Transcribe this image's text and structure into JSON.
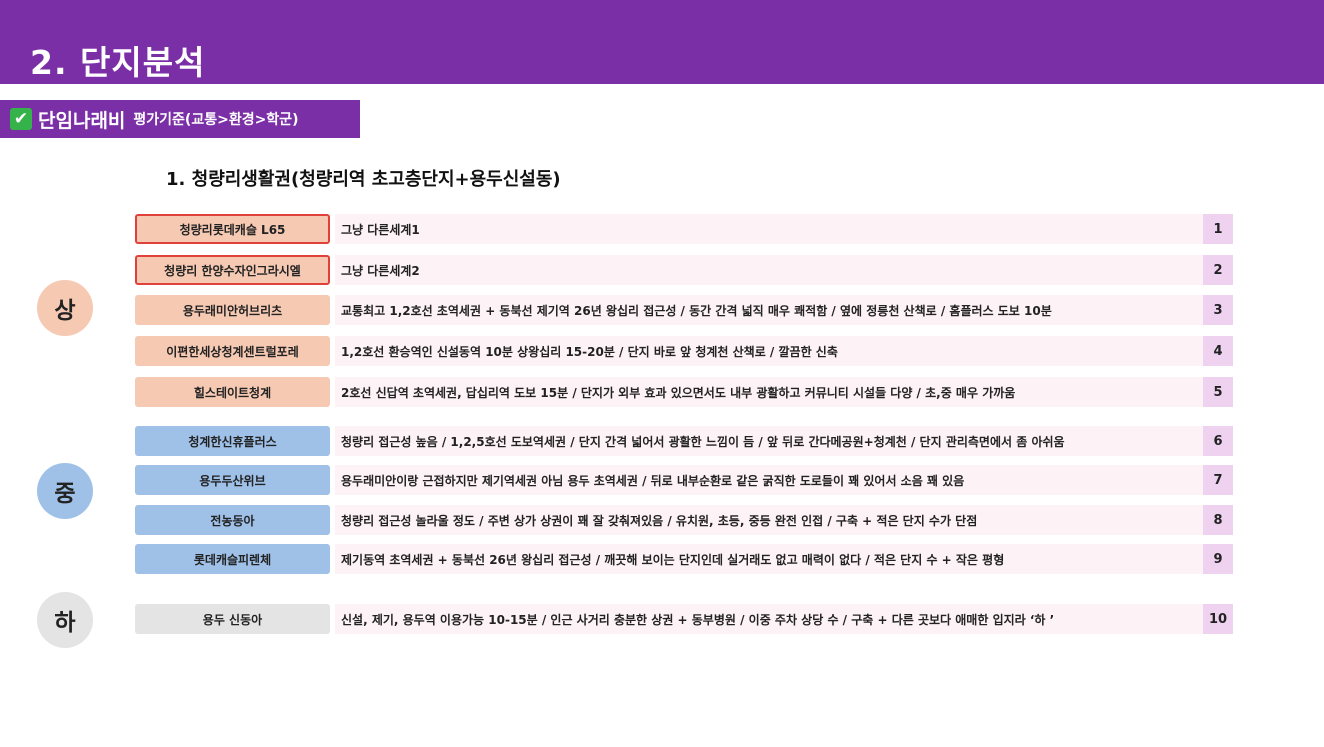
{
  "header": {
    "title": "2. 단지분석"
  },
  "badge": {
    "check": "✔",
    "title": "단임나래비",
    "criteria": "평가기준(교통>환경>학군)"
  },
  "section": {
    "title": "1. 청량리생활권(청량리역 초고층단지+용두신설동)"
  },
  "tiers": [
    {
      "label": "상",
      "color": "#f6c9b3"
    },
    {
      "label": "중",
      "color": "#9fc1e8"
    },
    {
      "label": "하",
      "color": "#e4e4e4"
    }
  ],
  "rows": [
    {
      "label": "청량리롯데캐슬 L65",
      "desc": "그냥 다른세계1",
      "num": "1",
      "color": "#f6c9b3",
      "outlined": true
    },
    {
      "label": "청량리 한양수자인그라시엘",
      "desc": "그냥 다른세계2",
      "num": "2",
      "color": "#f6c9b3",
      "outlined": true
    },
    {
      "label": "용두래미안허브리츠",
      "desc": "교통최고 1,2호선 초역세권 + 동북선 제기역 26년 왕십리 접근성 / 동간 간격 넓직 매우 쾌적함 / 옆에 정릉천 산책로 / 홈플러스 도보 10분",
      "num": "3",
      "color": "#f6c9b3",
      "outlined": false
    },
    {
      "label": "이편한세상청계센트럴포레",
      "desc": "1,2호선 환승역인 신설동역 10분 상왕십리 15-20분 / 단지 바로 앞 청계천 산책로 / 깔끔한 신축",
      "num": "4",
      "color": "#f6c9b3",
      "outlined": false
    },
    {
      "label": "힐스테이트청계",
      "desc": "2호선 신답역 초역세권, 답십리역 도보 15분 / 단지가 외부 효과 있으면서도 내부 광활하고 커뮤니티 시설들 다양 / 초,중 매우 가까움",
      "num": "5",
      "color": "#f6c9b3",
      "outlined": false
    },
    {
      "label": "청계한신휴플러스",
      "desc": "청량리 접근성 높음 / 1,2,5호선 도보역세권 / 단지 간격 넓어서 광활한 느낌이 듬 / 앞 뒤로 간다메공원+청계천 / 단지 관리측면에서 좀 아쉬움",
      "num": "6",
      "color": "#9fc1e8",
      "outlined": false
    },
    {
      "label": "용두두산위브",
      "desc": "용두래미안이랑 근접하지만 제기역세권 아님 용두 초역세권 / 뒤로 내부순환로 같은 굵직한 도로들이 꽤 있어서 소음 꽤 있음",
      "num": "7",
      "color": "#9fc1e8",
      "outlined": false
    },
    {
      "label": "전농동아",
      "desc": "청량리 접근성 놀라울 정도 / 주변 상가 상권이 꽤 잘 갖춰져있음 / 유치원, 초등, 중등 완전 인접 / 구축 + 적은 단지 수가 단점",
      "num": "8",
      "color": "#9fc1e8",
      "outlined": false
    },
    {
      "label": "롯데캐슬피렌체",
      "desc": "제기동역 초역세권 + 동북선 26년 왕십리 접근성 / 깨끗해 보이는 단지인데 실거래도 없고 매력이 없다 / 적은 단지 수 + 작은 평형",
      "num": "9",
      "color": "#9fc1e8",
      "outlined": false
    },
    {
      "label": "용두 신동아",
      "desc": "신설, 제기, 용두역 이용가능 10-15분 / 인근 사거리 충분한 상권 + 동부병원 / 이중 주차 상당 수 / 구축 + 다른 곳보다 애매한 입지라 ‘하 ’",
      "num": "10",
      "color": "#e4e4e4",
      "outlined": false
    }
  ]
}
